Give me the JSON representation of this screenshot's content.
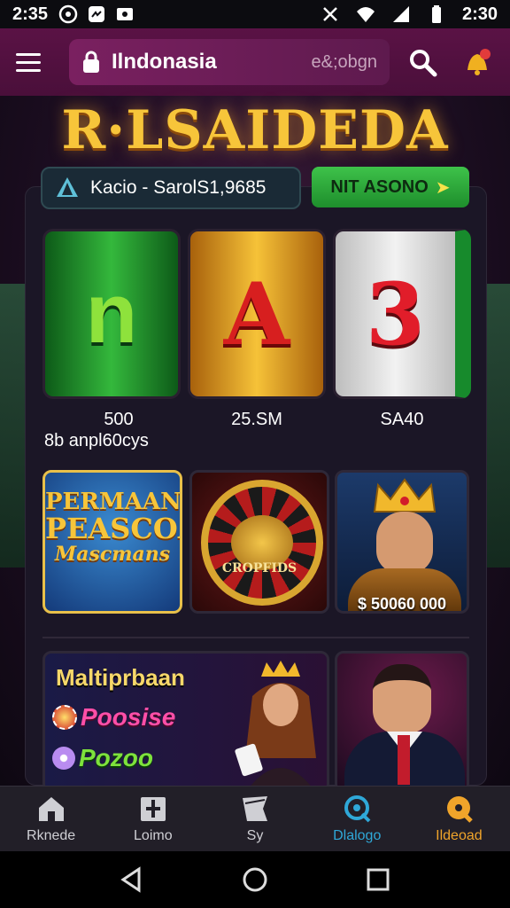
{
  "status_bar": {
    "time_left": "2:35",
    "time_right": "2:30"
  },
  "header": {
    "search_label": "Ilndonasia",
    "search_placeholder": "e&;obgn"
  },
  "title": "R·LSAIDEDA",
  "balance": {
    "text": "Kacio - SarolS1,9685"
  },
  "bonus_button": {
    "label": "NIT ASONO"
  },
  "reels": [
    {
      "glyph": "n",
      "caption": "500"
    },
    {
      "glyph": "A",
      "caption": "25.SM"
    },
    {
      "glyph": "3",
      "caption": "SA40"
    }
  ],
  "reel_sub": "8b anpl60cys",
  "games": {
    "tile_a": {
      "line1": "PERMAANA",
      "line2": "PEASCOA",
      "line3": "Mascmans"
    },
    "tile_b": {
      "caption": "CROPFIDS"
    },
    "tile_c": {
      "amount": "$ 50060 000"
    },
    "tile_d": {
      "heading": "Maltiprbaan",
      "promo1": "Poosise",
      "promo2": "Pozoo"
    }
  },
  "bottom_nav": [
    {
      "label": "Rknede",
      "icon": "home-icon",
      "state": "normal"
    },
    {
      "label": "Loimo",
      "icon": "gift-icon",
      "state": "normal"
    },
    {
      "label": "Sy",
      "icon": "flag-icon",
      "state": "normal"
    },
    {
      "label": "Dlalogo",
      "icon": "chat-icon",
      "state": "active-blue"
    },
    {
      "label": "Ildeoad",
      "icon": "chat-icon",
      "state": "active-orange"
    }
  ],
  "colors": {
    "header": "#5a1245",
    "accent_green": "#2fa83a",
    "title_gold": "#f7c53a",
    "nav_blue": "#2fa8d8",
    "nav_orange": "#f0a42a"
  }
}
